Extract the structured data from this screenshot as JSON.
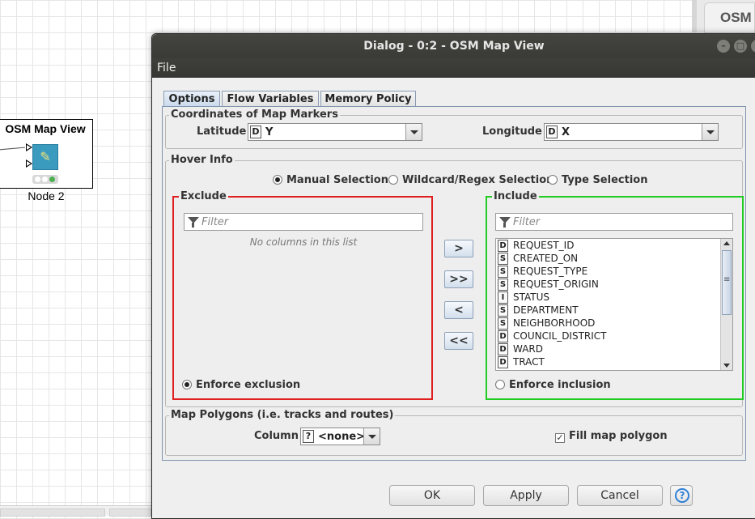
{
  "canvas": {
    "node": {
      "title": "OSM Map View",
      "label": "Node 2",
      "icon": "map-pin-icon",
      "status_colors": [
        "#ffffff",
        "#ffffff",
        "#4caf50"
      ]
    },
    "background_window_title": "OSM"
  },
  "dialog": {
    "title": "Dialog - 0:2 - OSM Map View",
    "menu": [
      "File"
    ],
    "tabs": [
      {
        "label": "Options",
        "active": true
      },
      {
        "label": "Flow Variables",
        "active": false
      },
      {
        "label": "Memory Policy",
        "active": false
      }
    ],
    "coordinates": {
      "group_title": "Coordinates of Map Markers",
      "latitude_label": "Latitude",
      "latitude_type": "D",
      "latitude_value": "Y",
      "longitude_label": "Longitude",
      "longitude_type": "D",
      "longitude_value": "X"
    },
    "hover_info": {
      "group_title": "Hover Info",
      "modes": [
        {
          "label": "Manual Selection",
          "selected": true
        },
        {
          "label": "Wildcard/Regex Selection",
          "selected": false
        },
        {
          "label": "Type Selection",
          "selected": false
        }
      ],
      "exclude": {
        "title": "Exclude",
        "border_color": "#e02020",
        "filter_placeholder": "Filter",
        "empty_text": "No columns in this list",
        "enforce_label": "Enforce exclusion",
        "enforce_selected": true
      },
      "include": {
        "title": "Include",
        "border_color": "#22cc22",
        "filter_placeholder": "Filter",
        "columns": [
          {
            "type": "D",
            "name": "REQUEST_ID"
          },
          {
            "type": "S",
            "name": "CREATED_ON"
          },
          {
            "type": "S",
            "name": "REQUEST_TYPE"
          },
          {
            "type": "S",
            "name": "REQUEST_ORIGIN"
          },
          {
            "type": "I",
            "name": "STATUS"
          },
          {
            "type": "S",
            "name": "DEPARTMENT"
          },
          {
            "type": "S",
            "name": "NEIGHBORHOOD"
          },
          {
            "type": "D",
            "name": "COUNCIL_DISTRICT"
          },
          {
            "type": "D",
            "name": "WARD"
          },
          {
            "type": "D",
            "name": "TRACT"
          }
        ],
        "enforce_label": "Enforce inclusion",
        "enforce_selected": false
      },
      "move_buttons": [
        ">",
        ">>",
        "<",
        "<<"
      ]
    },
    "polygons": {
      "group_title": "Map Polygons (i.e. tracks and routes)",
      "column_label": "Column",
      "column_type": "?",
      "column_value": "<none>",
      "fill_label": "Fill map polygon",
      "fill_checked": true
    },
    "buttons": {
      "ok": "OK",
      "apply": "Apply",
      "cancel": "Cancel",
      "help_icon": "help-icon"
    }
  }
}
